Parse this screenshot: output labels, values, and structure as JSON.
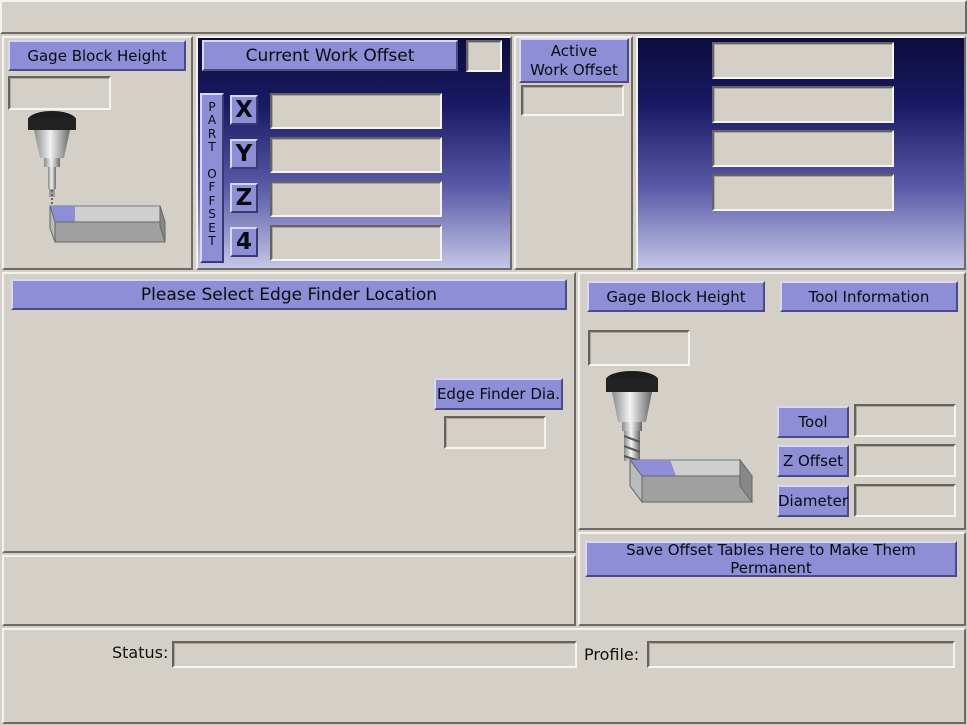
{
  "top_left": {
    "gage_label": "Gage Block Height"
  },
  "work_offset": {
    "title": "Current Work Offset",
    "part_offset_label": "P\nA\nR\nT\n \nO\nF\nF\nS\nE\nT",
    "axes": [
      "X",
      "Y",
      "Z",
      "4"
    ]
  },
  "active_offset": {
    "label_line1": "Active",
    "label_line2": "Work Offset"
  },
  "edge_finder": {
    "title": "Please Select Edge Finder Location",
    "dia_label": "Edge Finder Dia."
  },
  "tool_panel": {
    "gage_label": "Gage Block Height",
    "tool_info_label": "Tool Information",
    "tool_label": "Tool",
    "zoffset_label": "Z Offset",
    "diameter_label": "Diameter"
  },
  "save_panel": {
    "save_label": "Save Offset Tables Here to Make Them Permanent"
  },
  "status_bar": {
    "status_label": "Status:",
    "profile_label": "Profile:"
  }
}
